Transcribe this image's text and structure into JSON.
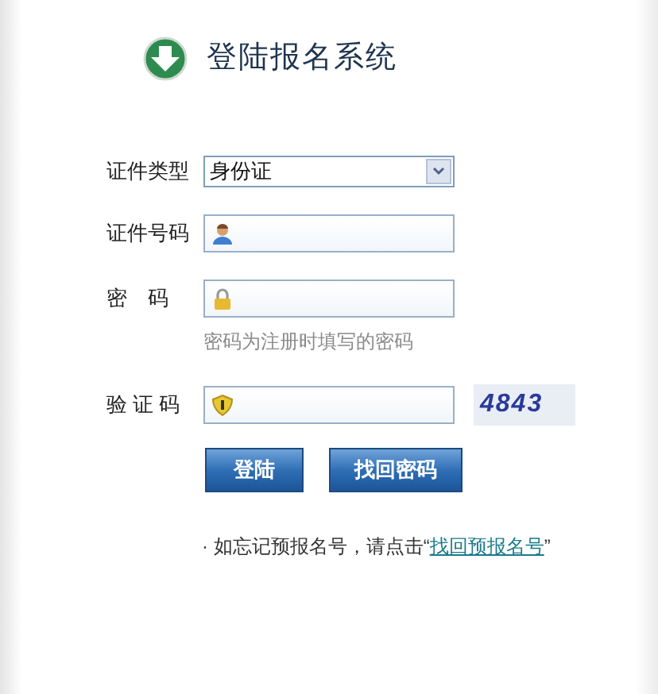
{
  "title": "登陆报名系统",
  "fields": [
    {
      "kind": "select",
      "label": "证件类型",
      "value": "身份证"
    },
    {
      "kind": "text",
      "label": "证件号码"
    },
    {
      "kind": "password",
      "label": "密　码",
      "hint": "密码为注册时填写的密码"
    },
    {
      "kind": "captcha",
      "label": "验 证 码",
      "captcha": "4843"
    }
  ],
  "buttons": [
    "登陆",
    "找回密码"
  ],
  "note": {
    "text": "· 如忘记预报名号，请点击“",
    "link": "找回预报名号",
    "after": "”"
  }
}
